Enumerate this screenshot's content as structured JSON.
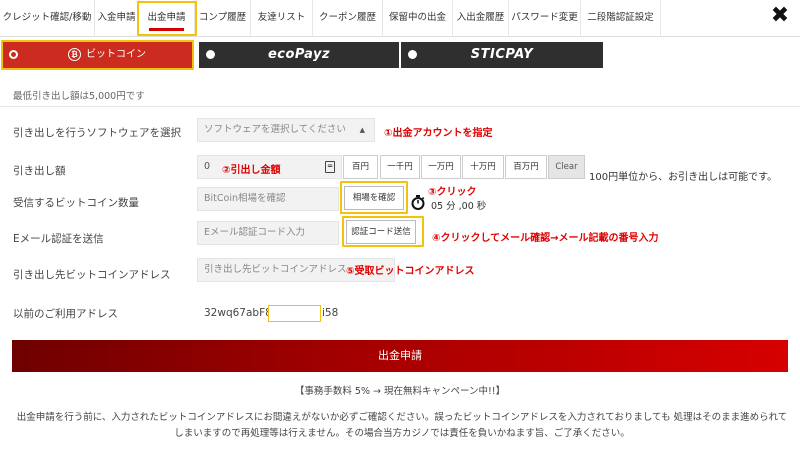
{
  "nav": {
    "tabs": [
      {
        "label": "クレジット確認/移動"
      },
      {
        "label": "入金申請"
      },
      {
        "label": "出金申請"
      },
      {
        "label": "コンプ履歴"
      },
      {
        "label": "友達リスト"
      },
      {
        "label": "クーポン履歴"
      },
      {
        "label": "保留中の出金"
      },
      {
        "label": "入出金履歴"
      },
      {
        "label": "パスワード変更"
      },
      {
        "label": "二段階認証設定"
      }
    ],
    "active_tab": "出金申請",
    "close_label": "✖"
  },
  "payment_methods": [
    {
      "label": "ビットコイン",
      "selected": true
    },
    {
      "label": "ecoPayz",
      "selected": false
    },
    {
      "label": "STICPAY",
      "selected": false
    }
  ],
  "min_note": "最低引き出し額は5,000円です",
  "form": {
    "software": {
      "label": "引き出しを行うソフトウェアを選択",
      "placeholder": "ソフトウェアを選択してください",
      "note": "①出金アカウントを指定"
    },
    "amount": {
      "label": "引き出し額",
      "value": "0",
      "note": "②引出し金額",
      "buttons": [
        "百円",
        "一千円",
        "一万円",
        "十万円",
        "百万円",
        "Clear"
      ],
      "unit_note": "100円単位から、お引き出しは可能です。"
    },
    "btc_qty": {
      "label": "受信するビットコイン数量",
      "placeholder": "BitCoin相場を確認",
      "button": "相場を確認",
      "note": "③クリック",
      "timer": "05 分 ,00 秒"
    },
    "email": {
      "label": "Eメール認証を送信",
      "placeholder": "Eメール認証コード入力",
      "button": "認証コード送信",
      "note": "④クリックしてメール確認→メール記載の番号入力"
    },
    "address": {
      "label": "引き出し先ビットコインアドレス",
      "placeholder": "引き出し先ビットコインアドレス",
      "note": "⑤受取ビットコインアドレス"
    },
    "previous": {
      "label": "以前のご利用アドレス",
      "address_start": "32wq67abF8",
      "address_end": "i58"
    }
  },
  "submit_label": "出金申請",
  "fee_note": "【事務手数料 5% → 現在無料キャンペーン中!!】",
  "warning": "出金申請を行う前に、入力されたビットコインアドレスにお間違えがないか必ずご確認ください。誤ったビットコインアドレスを入力されておりましても 処理はそのまま進められてしまいますので再処理等は行えません。その場合当方カジノでは責任を負いかねます旨、ご了承ください。",
  "colors": {
    "accent_red": "#d40000",
    "annotation_red": "#e00000",
    "highlight_yellow": "#f4c20d",
    "bitcoin_red": "#cc2b20",
    "dark_bar": "#2f2f2f"
  }
}
